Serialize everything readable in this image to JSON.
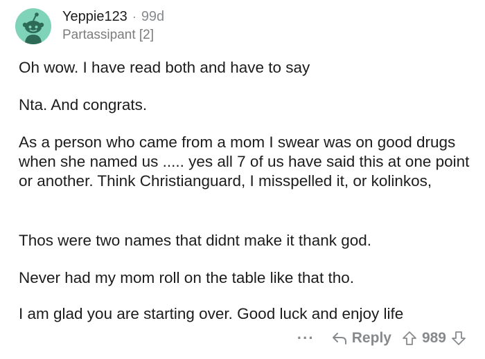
{
  "comment": {
    "username": "Yeppie123",
    "separator": "·",
    "age": "99d",
    "flair": "Partassipant [2]",
    "paragraphs": [
      "Oh wow. I have read both and have to say",
      "Nta. And congrats.",
      "As a person who came from a mom I swear was on good drugs when she named us ..... yes all 7 of us have said this at one point or another. Think Christianguard, I misspelled it, or kolinkos,",
      "Thos were two names that didnt make it thank god.",
      "Never had my mom roll on the table like that tho.",
      "I am glad you are starting over. Good luck and enjoy life"
    ]
  },
  "actions": {
    "more_label": "···",
    "reply_label": "Reply",
    "score": "989",
    "icons": {
      "reply": "reply-arrow-icon",
      "upvote": "upvote-arrow-icon",
      "downvote": "downvote-arrow-icon"
    }
  },
  "colors": {
    "avatar_bg": "#7fd3b8",
    "meta_gray": "#878a8c",
    "text": "#1c1c1c"
  }
}
